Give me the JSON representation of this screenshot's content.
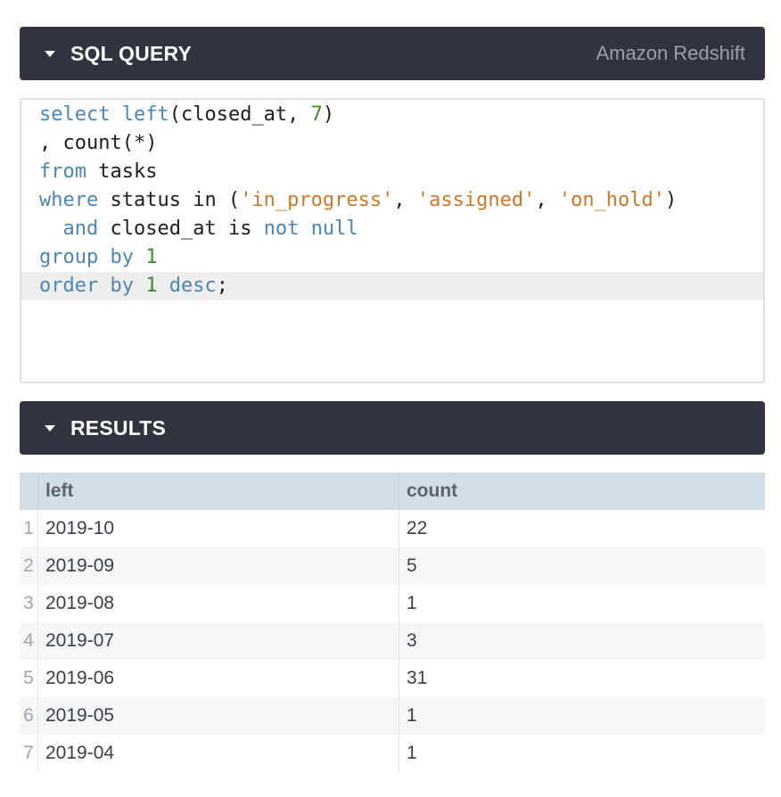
{
  "sql_panel": {
    "title": "SQL QUERY",
    "engine": "Amazon Redshift"
  },
  "editor": {
    "lines": [
      [
        {
          "t": "select",
          "c": "kw"
        },
        {
          "t": " "
        },
        {
          "t": "left",
          "c": "kw"
        },
        {
          "t": "(closed_at, "
        },
        {
          "t": "7",
          "c": "num"
        },
        {
          "t": ")"
        }
      ],
      [
        {
          "t": ", count(*)"
        }
      ],
      [
        {
          "t": "from",
          "c": "kw"
        },
        {
          "t": " tasks"
        }
      ],
      [
        {
          "t": "where",
          "c": "kw"
        },
        {
          "t": " status in ("
        },
        {
          "t": "'in_progress'",
          "c": "str"
        },
        {
          "t": ", "
        },
        {
          "t": "'assigned'",
          "c": "str"
        },
        {
          "t": ", "
        },
        {
          "t": "'on_hold'",
          "c": "str"
        },
        {
          "t": ")"
        }
      ],
      [
        {
          "t": "  "
        },
        {
          "t": "and",
          "c": "kw"
        },
        {
          "t": " closed_at is "
        },
        {
          "t": "not",
          "c": "kw"
        },
        {
          "t": " "
        },
        {
          "t": "null",
          "c": "kw"
        }
      ],
      [
        {
          "t": "group by",
          "c": "kw"
        },
        {
          "t": " "
        },
        {
          "t": "1",
          "c": "num"
        }
      ],
      [
        {
          "t": "order by",
          "c": "kw"
        },
        {
          "t": " "
        },
        {
          "t": "1",
          "c": "num"
        },
        {
          "t": " "
        },
        {
          "t": "desc",
          "c": "kw"
        },
        {
          "t": ";"
        }
      ]
    ],
    "active_line": 6
  },
  "results_panel": {
    "title": "RESULTS"
  },
  "results": {
    "columns": [
      "left",
      "count"
    ],
    "rows": [
      {
        "n": "1",
        "left": "2019-10",
        "count": "22"
      },
      {
        "n": "2",
        "left": "2019-09",
        "count": "5"
      },
      {
        "n": "3",
        "left": "2019-08",
        "count": "1"
      },
      {
        "n": "4",
        "left": "2019-07",
        "count": "3"
      },
      {
        "n": "5",
        "left": "2019-06",
        "count": "31"
      },
      {
        "n": "6",
        "left": "2019-05",
        "count": "1"
      },
      {
        "n": "7",
        "left": "2019-04",
        "count": "1"
      }
    ]
  },
  "colors": {
    "header_bg": "#2f343f",
    "keyword": "#4b86b4",
    "number": "#3f8b2f",
    "string": "#c8792f",
    "table_header_bg": "#d3dde6"
  }
}
